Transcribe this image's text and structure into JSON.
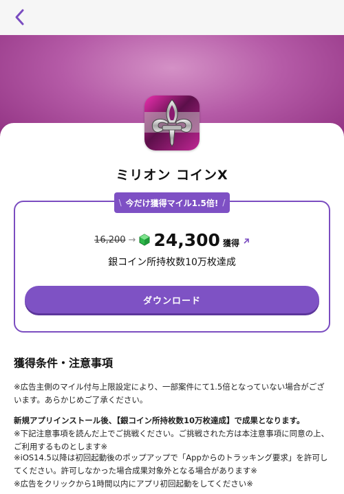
{
  "nav": {
    "back_icon": "chevron-left-icon"
  },
  "colors": {
    "accent": "#7e52c4",
    "hero": "#b55ba7"
  },
  "app": {
    "name": "ミリオン コインX",
    "icon": "fleur-de-lis-icon"
  },
  "offer": {
    "badge_text": "今だけ獲得マイル1.5倍!",
    "badge_left": "\\",
    "badge_right": "/",
    "old_price": "16,200",
    "new_price": "24,300",
    "unit": "獲得",
    "gem_icon": "green-gem-icon",
    "condition": "銀コイン所持枚数10万枚達成",
    "download_label": "ダウンロード"
  },
  "notes": {
    "title": "獲得条件・注意事項",
    "p1": "※広告主側のマイル付与上限設定により、一部案件にて1.5倍となっていない場合がございます。あらかじめご了承ください。",
    "p2": "新規アプリインストール後、【銀コイン所持枚数10万枚達成】で成果となります。",
    "p3": "※下記注意事項を読んだ上でご挑戦ください。ご挑戦された方は本注意事項に同意の上、ご利用するものとします※",
    "p4": "※iOS14.5以降は初回起動後のポップアップで「Appからのトラッキング要求」を許可してください。許可しなかった場合成果対象外となる場合があります※",
    "p5": "※広告をクリックから1時間以内にアプリ初回起動をしてください※"
  }
}
